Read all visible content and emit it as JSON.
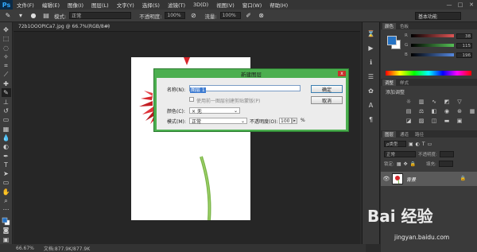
{
  "app": {
    "logo": "Ps",
    "menu": [
      "文件(F)",
      "编辑(E)",
      "图像(I)",
      "图层(L)",
      "文字(Y)",
      "选择(S)",
      "滤镜(T)",
      "3D(D)",
      "视图(V)",
      "窗口(W)",
      "帮助(H)"
    ],
    "window_controls": [
      "—",
      "□",
      "✕"
    ]
  },
  "options": {
    "mode_label": "模式:",
    "mode_value": "正常",
    "opacity_label": "不透明度:",
    "opacity_value": "100%",
    "flow_label": "流量:",
    "flow_value": "100%",
    "workspace": "基本功能"
  },
  "document": {
    "tab_title": "72b1OOOPICa7.jpg @ 66.7%(RGB/8#)",
    "tab_close": "×"
  },
  "status": {
    "zoom": "66.67%",
    "doc_size": "文档:877.9K/877.9K"
  },
  "panels": {
    "color_tabs": [
      "颜色",
      "色板"
    ],
    "color_sliders": [
      {
        "label": "R",
        "value": "38",
        "color": "#e05555"
      },
      {
        "label": "G",
        "value": "115",
        "color": "#55c055"
      },
      {
        "label": "B",
        "value": "196",
        "color": "#5588e0"
      }
    ],
    "fg_color": "#2673c4",
    "bg_color": "#ffffff",
    "adjust_tabs": [
      "调整",
      "样式"
    ],
    "adjust_title": "添加调整",
    "layers_tabs": [
      "图层",
      "通道",
      "路径"
    ],
    "layer_kind": "ρ类型",
    "layer_blend": "正常",
    "layer_opacity_label": "不透明度:",
    "layer_fill_label": "填充:",
    "lock_label": "锁定:",
    "layer_name": "背景"
  },
  "dialog": {
    "title": "新建图层",
    "close": "x",
    "name_label": "名称(N):",
    "name_value": "图层 1",
    "clip_label": "使用前一图层创建剪贴蒙版(P)",
    "color_label": "颜色(C):",
    "color_value": "× 无",
    "mode_label": "模式(M):",
    "mode_value": "正常",
    "opacity_label": "不透明度(O):",
    "opacity_value": "100",
    "percent": "%",
    "ok": "确定",
    "cancel": "取消"
  },
  "watermark": {
    "logo": "Bai 经验",
    "url": "jingyan.baidu.com"
  }
}
